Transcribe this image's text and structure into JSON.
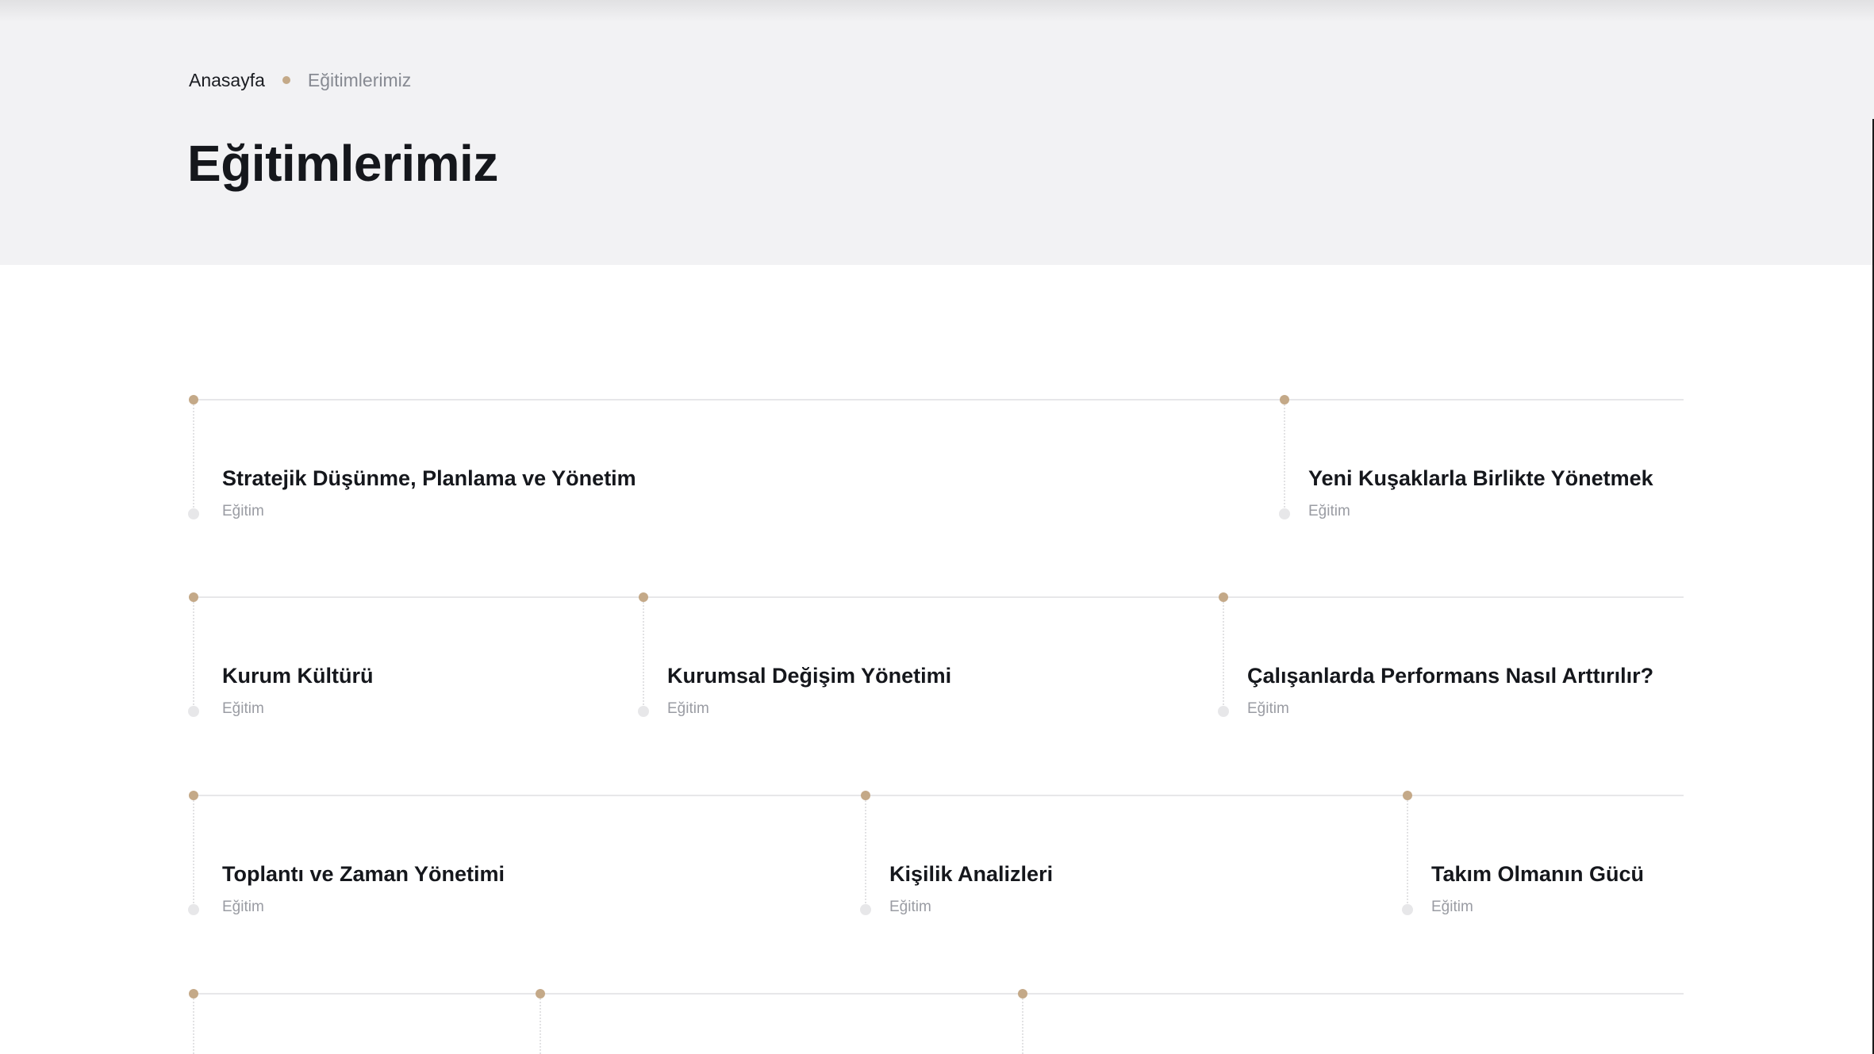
{
  "breadcrumb": {
    "home": "Anasayfa",
    "current": "Eğitimlerimiz"
  },
  "page": {
    "title": "Eğitimlerimiz"
  },
  "colors": {
    "accent": "#c4a988",
    "hero_background": "#f2f2f4",
    "title_text": "#15171c",
    "muted_text": "#9a9ca3"
  },
  "trainings": {
    "rows": [
      [
        {
          "title": "Stratejik Düşünme, Planlama ve Yönetim",
          "category": "Eğitim"
        },
        {
          "title": "Yeni Kuşaklarla Birlikte Yönetmek",
          "category": "Eğitim"
        }
      ],
      [
        {
          "title": "Kurum Kültürü",
          "category": "Eğitim"
        },
        {
          "title": "Kurumsal Değişim Yönetimi",
          "category": "Eğitim"
        },
        {
          "title": "Çalışanlarda Performans Nasıl Arttırılır?",
          "category": "Eğitim"
        }
      ],
      [
        {
          "title": "Toplantı ve Zaman Yönetimi",
          "category": "Eğitim"
        },
        {
          "title": "Kişilik Analizleri",
          "category": "Eğitim"
        },
        {
          "title": "Takım Olmanın Gücü",
          "category": "Eğitim"
        }
      ]
    ]
  }
}
